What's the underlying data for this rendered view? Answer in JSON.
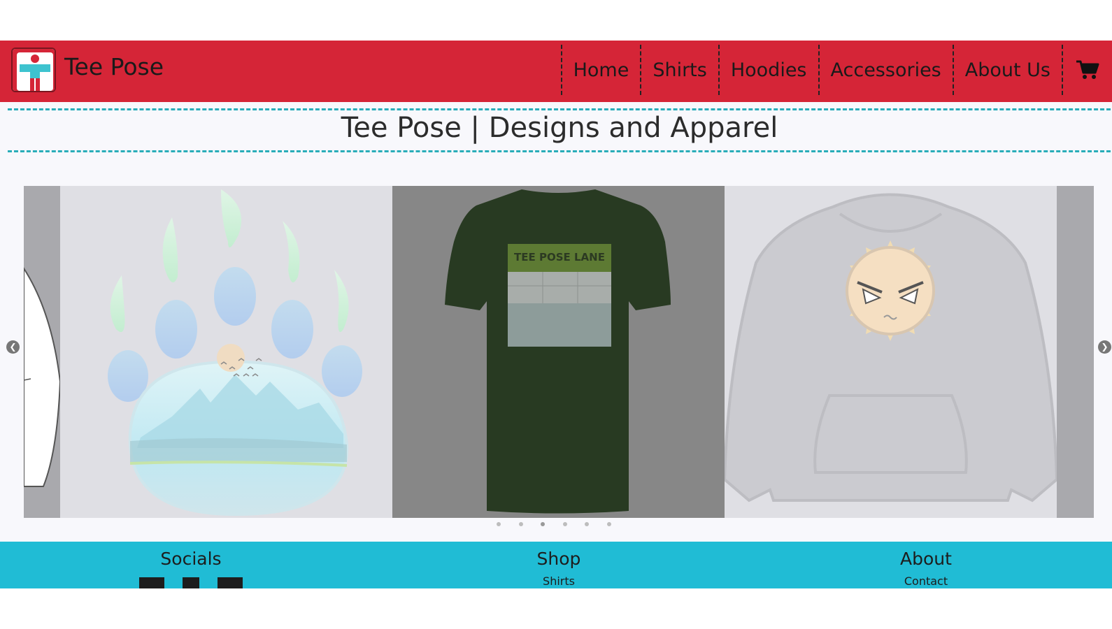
{
  "brand": {
    "name": "Tee Pose"
  },
  "nav": {
    "items": [
      {
        "label": "Home"
      },
      {
        "label": "Shirts"
      },
      {
        "label": "Hoodies"
      },
      {
        "label": "Accessories"
      },
      {
        "label": "About Us"
      }
    ],
    "cart_icon": "shopping-cart-icon"
  },
  "page": {
    "title": "Tee Pose | Designs and Apparel"
  },
  "carousel": {
    "slide_count": 6,
    "active_index": 2,
    "slides": [
      {
        "name": "partial-white-shirt"
      },
      {
        "name": "bear-paw-landscape-design"
      },
      {
        "name": "dark-green-tee-pose-lane-shirt",
        "print_text": "TEE POSE LANE"
      },
      {
        "name": "gray-hoodie-angry-sun"
      }
    ],
    "prev_icon": "chevron-left-icon",
    "next_icon": "chevron-right-icon"
  },
  "footer": {
    "socials": {
      "heading": "Socials",
      "icons": [
        "social-icon-1",
        "social-icon-2",
        "social-icon-3"
      ]
    },
    "shop": {
      "heading": "Shop",
      "links": [
        "Shirts"
      ]
    },
    "about": {
      "heading": "About",
      "links": [
        "Contact"
      ]
    }
  },
  "colors": {
    "header_bg": "#d52537",
    "accent_teal": "#29adb9",
    "footer_bg": "#20bcd5",
    "page_bg": "#f8f8fc",
    "shirt_green": "#283a22"
  }
}
